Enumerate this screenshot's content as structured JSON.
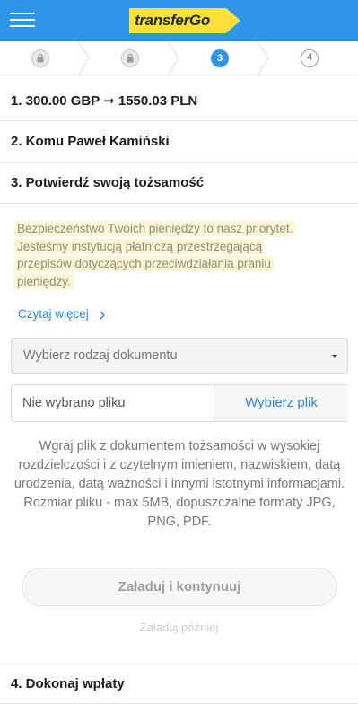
{
  "header": {
    "menu_icon": "hamburger-menu-icon",
    "logo_text": "transferGo",
    "background": "#2e95e8",
    "logo_color": "#fbe13a"
  },
  "steps": [
    {
      "state": "done",
      "icon": "lock-icon"
    },
    {
      "state": "done",
      "icon": "lock-icon"
    },
    {
      "state": "active",
      "label": "3"
    },
    {
      "state": "future",
      "label": "4"
    }
  ],
  "sections": {
    "s1": "1. 300.00 GBP ➞ 1550.03 PLN",
    "s2": "2. Komu Paweł Kamiński",
    "s3": "3. Potwierdź swoją tożsamość",
    "s4": "4. Dokonaj wpłaty"
  },
  "notice": {
    "lines": [
      "Bezpieczeństwo Twoich pieniędzy to nasz priorytet.",
      "Jesteśmy instytucją płatniczą przestrzegającą",
      "przepisów dotyczących przeciwdziałania praniu",
      "pieniędzy."
    ]
  },
  "read_more": "Czytaj więcej",
  "document_select": {
    "placeholder": "Wybierz rodzaj dokumentu"
  },
  "file": {
    "status": "Nie wybrano pliku",
    "button": "Wybierz plik"
  },
  "info": {
    "line1": "Wgraj plik z dokumentem tożsamości w wysokiej rozdzielczości i z czytelnym imieniem, nazwiskiem, datą urodzenia, datą ważności i innymi istotnymi informacjami.",
    "line2": "Rozmiar pliku - max 5MB, dopuszczalne formaty JPG, PNG, PDF."
  },
  "actions": {
    "upload": "Załaduj i kontynuuj",
    "later": "Załaduj później"
  }
}
